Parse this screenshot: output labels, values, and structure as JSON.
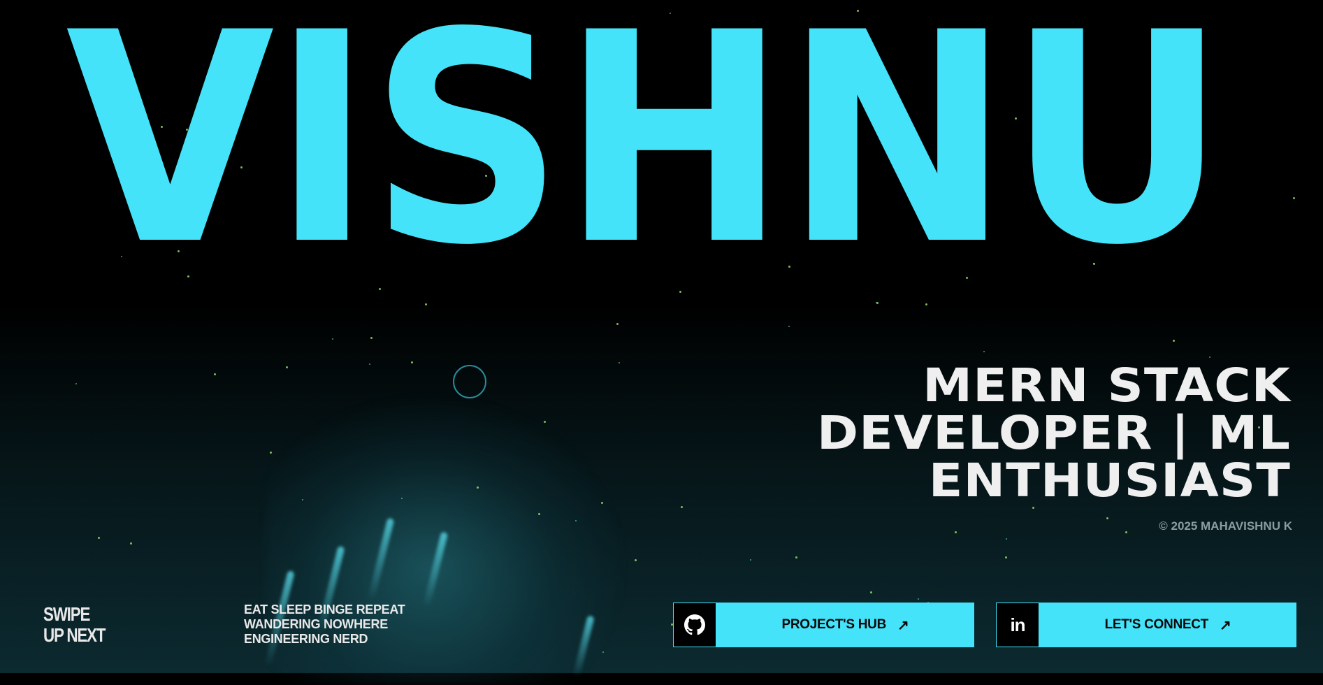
{
  "hero": {
    "name": "VISHNU"
  },
  "role": {
    "lines": [
      "MERN STACK",
      "DEVELOPER | ML",
      "ENTHUSIAST"
    ]
  },
  "copyright": "© 2025 MAHAVISHNU K",
  "swipe": {
    "line1": "SWIPE",
    "line2": "UP NEXT"
  },
  "tagline": {
    "lines": [
      "EAT SLEEP BINGE REPEAT",
      "WANDERING NOWHERE",
      "ENGINEERING NERD"
    ]
  },
  "buttons": {
    "projects": {
      "label": "PROJECT'S HUB",
      "icon": "github-icon",
      "arrow": "↗"
    },
    "connect": {
      "label": "LET'S CONNECT",
      "icon": "linkedin-icon",
      "icon_text": "in",
      "arrow": "↗"
    }
  },
  "colors": {
    "accent": "#45e3f9",
    "background": "#000000",
    "text": "#efefef"
  }
}
